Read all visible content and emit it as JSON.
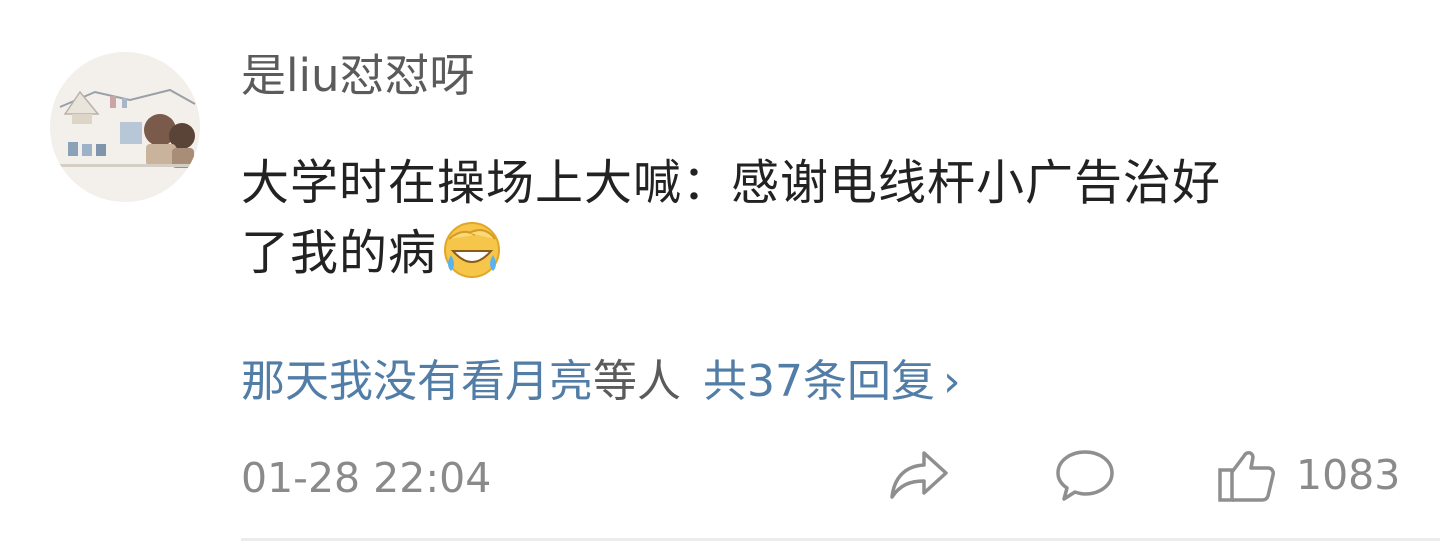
{
  "comment": {
    "username": "是liu怼怼呀",
    "text_line1": "大学时在操场上大喊：感谢电线杆小广告治好",
    "text_line2": "了我的病",
    "emoji": "laughing-crying-face-icon",
    "replies": {
      "user": "那天我没有看月亮",
      "suffix": "等人",
      "count_text": "共37条回复",
      "chevron": "›"
    },
    "timestamp": "01-28 22:04",
    "like_count": "1083"
  },
  "colors": {
    "link": "#517da6",
    "text": "#222222",
    "muted": "#8a8a8a",
    "username": "#5b5b5b"
  }
}
